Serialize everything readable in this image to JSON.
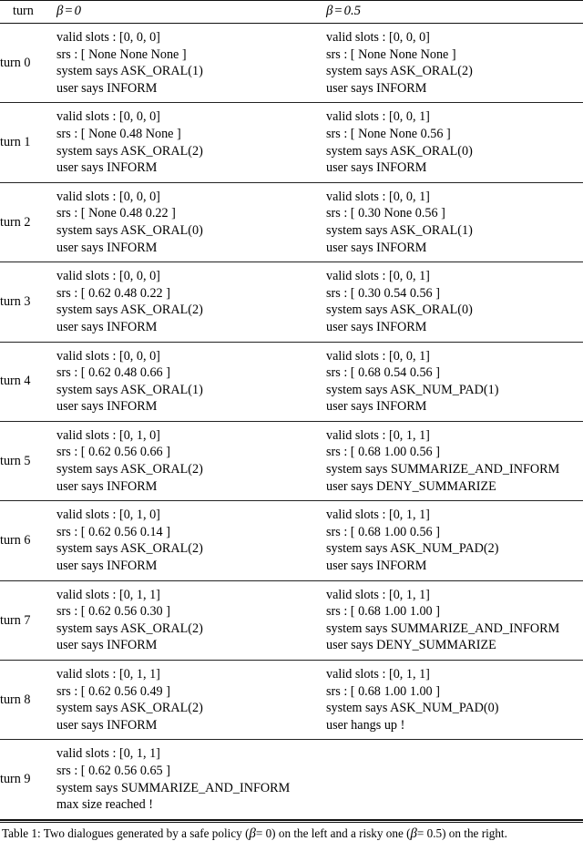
{
  "table": {
    "header": {
      "turn_label": "turn",
      "col_left": {
        "symbol": "β",
        "relation": "=",
        "value": "0",
        "full": "β = 0"
      },
      "col_right": {
        "symbol": "β",
        "relation": "=",
        "value": "0.5",
        "full": "β = 0.5"
      }
    },
    "rows": [
      {
        "turn": "turn 0",
        "left": [
          "valid slots : [0, 0, 0]",
          "srs : [ None None None ]",
          "system says ASK_ORAL(1)",
          "user says INFORM"
        ],
        "right": [
          "valid slots : [0, 0, 0]",
          "srs : [ None None None ]",
          "system says ASK_ORAL(2)",
          "user says INFORM"
        ]
      },
      {
        "turn": "turn 1",
        "left": [
          "valid slots : [0, 0, 0]",
          "srs : [ None 0.48 None ]",
          "system says ASK_ORAL(2)",
          "user says INFORM"
        ],
        "right": [
          "valid slots : [0, 0, 1]",
          "srs : [ None None 0.56 ]",
          "system says ASK_ORAL(0)",
          "user says INFORM"
        ]
      },
      {
        "turn": "turn 2",
        "left": [
          "valid slots : [0, 0, 0]",
          "srs : [ None 0.48 0.22 ]",
          "system says ASK_ORAL(0)",
          "user says INFORM"
        ],
        "right": [
          "valid slots : [0, 0, 1]",
          "srs : [ 0.30 None 0.56 ]",
          "system says ASK_ORAL(1)",
          "user says INFORM"
        ]
      },
      {
        "turn": "turn 3",
        "left": [
          "valid slots : [0, 0, 0]",
          "srs : [ 0.62 0.48 0.22 ]",
          "system says ASK_ORAL(2)",
          "user says INFORM"
        ],
        "right": [
          "valid slots : [0, 0, 1]",
          "srs : [ 0.30 0.54 0.56 ]",
          "system says ASK_ORAL(0)",
          "user says INFORM"
        ]
      },
      {
        "turn": "turn 4",
        "left": [
          "valid slots : [0, 0, 0]",
          "srs : [ 0.62 0.48 0.66 ]",
          "system says ASK_ORAL(1)",
          "user says INFORM"
        ],
        "right": [
          "valid slots : [0, 0, 1]",
          "srs : [ 0.68 0.54 0.56 ]",
          "system says ASK_NUM_PAD(1)",
          "user says INFORM"
        ]
      },
      {
        "turn": "turn 5",
        "left": [
          "valid slots : [0, 1, 0]",
          "srs : [ 0.62 0.56 0.66 ]",
          "system says ASK_ORAL(2)",
          "user says INFORM"
        ],
        "right": [
          "valid slots : [0, 1, 1]",
          "srs : [ 0.68 1.00 0.56 ]",
          "system says SUMMARIZE_AND_INFORM",
          "user says DENY_SUMMARIZE"
        ]
      },
      {
        "turn": "turn 6",
        "left": [
          "valid slots : [0, 1, 0]",
          "srs : [ 0.62 0.56 0.14 ]",
          "system says ASK_ORAL(2)",
          "user says INFORM"
        ],
        "right": [
          "valid slots : [0, 1, 1]",
          "srs : [ 0.68 1.00 0.56 ]",
          "system says ASK_NUM_PAD(2)",
          "user says INFORM"
        ]
      },
      {
        "turn": "turn 7",
        "left": [
          "valid slots : [0, 1, 1]",
          "srs : [ 0.62 0.56 0.30 ]",
          "system says ASK_ORAL(2)",
          "user says INFORM"
        ],
        "right": [
          "valid slots : [0, 1, 1]",
          "srs : [ 0.68 1.00 1.00 ]",
          "system says SUMMARIZE_AND_INFORM",
          "user says DENY_SUMMARIZE"
        ]
      },
      {
        "turn": "turn 8",
        "left": [
          "valid slots : [0, 1, 1]",
          "srs : [ 0.62 0.56 0.49 ]",
          "system says ASK_ORAL(2)",
          "user says INFORM"
        ],
        "right": [
          "valid slots : [0, 1, 1]",
          "srs : [ 0.68 1.00 1.00 ]",
          "system says ASK_NUM_PAD(0)",
          "user hangs up !"
        ]
      },
      {
        "turn": "turn 9",
        "left": [
          "valid slots : [0, 1, 1]",
          "srs : [ 0.62 0.56 0.65 ]",
          "system says SUMMARIZE_AND_INFORM",
          "max size reached !"
        ],
        "right": []
      }
    ]
  },
  "caption": {
    "prefix": "Table 1: Two dialogues generated by a safe policy (",
    "beta1": "β",
    "eq1": "= 0",
    "middle": ") on the left and a risky one (",
    "beta2": "β",
    "eq2": "= 0.5",
    "suffix": ") on the right."
  }
}
